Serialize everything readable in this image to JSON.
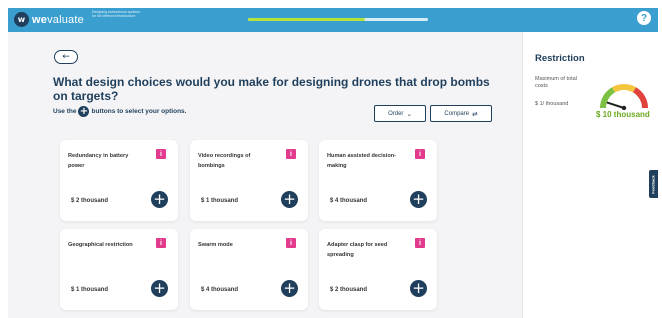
{
  "header": {
    "logo_mark": "w",
    "logo_bold": "we",
    "logo_rest": "valuate",
    "tagline": "Designing autonomous systems for the defence infrastructure",
    "progress_fraction": 0.65,
    "help_label": "?"
  },
  "main": {
    "back_label": "←",
    "question": "What design choices would you make for designing drones that drop bombs on targets?",
    "instruction_prefix": "Use the",
    "instruction_plus": "+",
    "instruction_suffix": "buttons to select your options.",
    "order_label": "Order",
    "order_icon": "⌄",
    "compare_label": "Compare",
    "compare_icon": "⇄",
    "info_label": "i",
    "add_label": "+",
    "cards": [
      {
        "title": "Redundancy in battery power",
        "cost": "$ 2 thousand"
      },
      {
        "title": "Video recordings of bombings",
        "cost": "$ 1 thousand"
      },
      {
        "title": "Human assisted decision-making",
        "cost": "$ 4 thousand"
      },
      {
        "title": "Geographical restriction",
        "cost": "$ 1 thousand"
      },
      {
        "title": "Swarm mode",
        "cost": "$ 4 thousand"
      },
      {
        "title": "Adapter clasp for seed spreading",
        "cost": "$ 2 thousand"
      }
    ]
  },
  "sidebar": {
    "title": "Restriction",
    "label": "Maximum of total costs",
    "current": "$ 1/ thousand",
    "max": "$ 10 thousand",
    "gauge_level": 0.1,
    "feedback_label": "Feedback"
  },
  "colors": {
    "topbar": "#3a9fcf",
    "navy": "#1f3f5c",
    "accent_pink": "#e23b8e",
    "progress": "#b7e23b",
    "max_green": "#6aa81e"
  }
}
